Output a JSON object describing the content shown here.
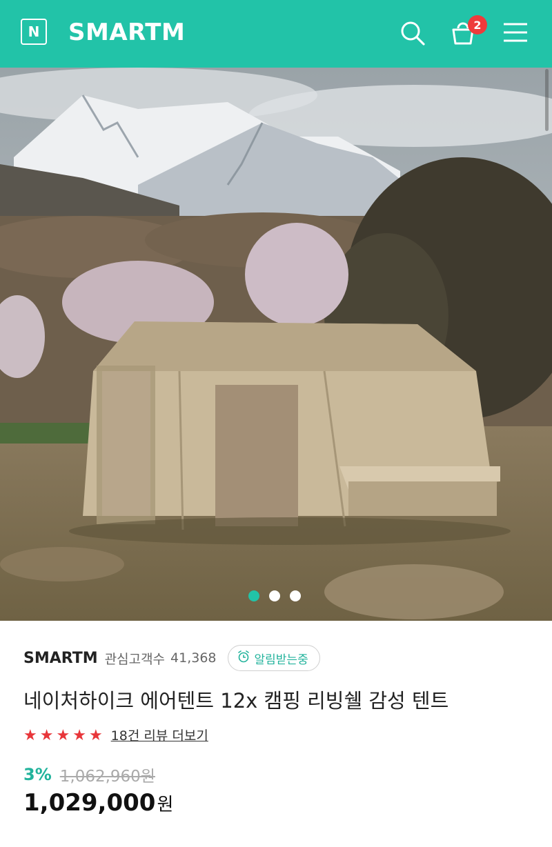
{
  "header": {
    "logo_letter": "N",
    "brand": "SMARTM",
    "cart_count": "2",
    "accent_color": "#22c3a8",
    "icons": [
      "search-icon",
      "cart-icon",
      "menu-icon"
    ]
  },
  "gallery": {
    "image_alt": "Beige air tent in a field with snowy mountains",
    "slide_count": 3,
    "active_index": 0
  },
  "seller": {
    "name": "SMARTM",
    "followers_label": "관심고객수",
    "followers_count": "41,368",
    "notify_label": "알림받는중"
  },
  "product": {
    "title": "네이처하이크 에어텐트 12x 캠핑 리빙쉘 감성 텐트",
    "rating_stars": 5,
    "review_link": "18건 리뷰 더보기",
    "discount": "3%",
    "original_price": "1,062,960원",
    "price": "1,029,000",
    "currency": "원"
  }
}
